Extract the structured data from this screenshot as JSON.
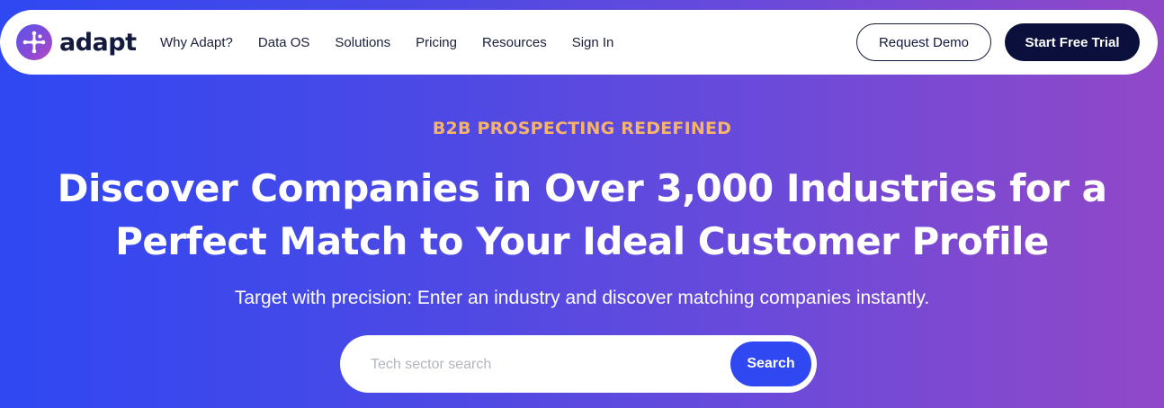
{
  "brand": {
    "name": "adapt",
    "logo_icon": "starburst-logo-icon"
  },
  "nav": {
    "links": [
      "Why Adapt?",
      "Data OS",
      "Solutions",
      "Pricing",
      "Resources",
      "Sign In"
    ],
    "request_demo_label": "Request Demo",
    "start_trial_label": "Start Free Trial"
  },
  "hero": {
    "eyebrow": "B2B PROSPECTING REDEFINED",
    "headline_line1": "Discover Companies in Over 3,000 Industries for a",
    "headline_line2": "Perfect Match to Your Ideal Customer Profile",
    "subheadline": "Target with precision: Enter an industry and discover matching companies instantly."
  },
  "search": {
    "placeholder": "Tech sector search",
    "value": "",
    "button_label": "Search"
  },
  "colors": {
    "gradient_start": "#2f48f2",
    "gradient_end": "#9148c8",
    "eyebrow": "#f6b36a",
    "primary_button": "#0b0f3b",
    "search_button": "#2f48f2"
  }
}
